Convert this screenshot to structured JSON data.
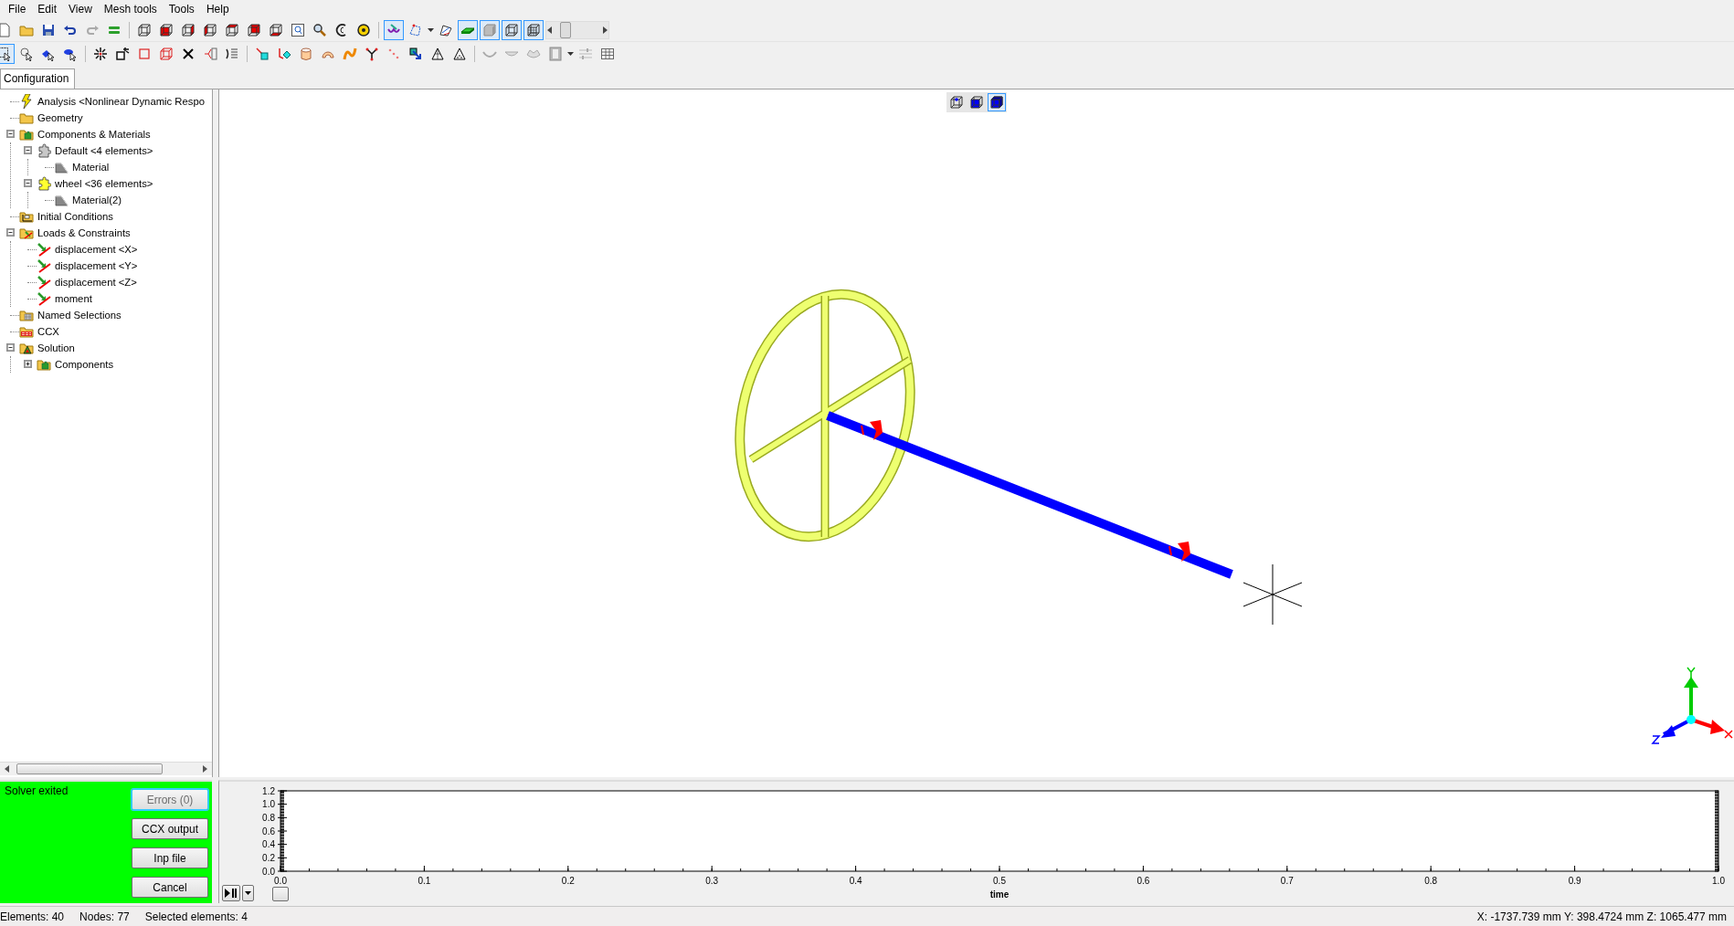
{
  "menu": [
    "File",
    "Edit",
    "View",
    "Mesh tools",
    "Tools",
    "Help"
  ],
  "tabs": [
    {
      "label": "Configuration",
      "selected": true
    }
  ],
  "tree": [
    {
      "kind": "analysis",
      "label": "Analysis <Nonlinear Dynamic Respo"
    },
    {
      "kind": "folder",
      "label": "Geometry"
    },
    {
      "kind": "components",
      "label": "Components & Materials",
      "expanded": true,
      "children": [
        {
          "kind": "part",
          "color": "#c8c8c8",
          "label": "Default <4 elements>",
          "expanded": true,
          "children": [
            {
              "kind": "material",
              "label": "Material"
            }
          ]
        },
        {
          "kind": "part",
          "color": "#ffff30",
          "label": "wheel <36 elements>",
          "expanded": true,
          "children": [
            {
              "kind": "material",
              "label": "Material(2)"
            }
          ]
        }
      ]
    },
    {
      "kind": "conditions",
      "label": "Initial Conditions"
    },
    {
      "kind": "loads",
      "label": "Loads & Constraints",
      "expanded": true,
      "children": [
        {
          "kind": "load",
          "label": "displacement <X>"
        },
        {
          "kind": "load",
          "label": "displacement <Y>"
        },
        {
          "kind": "load",
          "label": "displacement <Z>"
        },
        {
          "kind": "load",
          "label": "moment"
        }
      ]
    },
    {
      "kind": "selections",
      "label": "Named Selections"
    },
    {
      "kind": "ccx",
      "label": "CCX"
    },
    {
      "kind": "solution",
      "label": "Solution",
      "expanded": true,
      "children": [
        {
          "kind": "components",
          "label": "Components",
          "expanded": false
        }
      ]
    }
  ],
  "view_modes": [
    {
      "selected": false
    },
    {
      "selected": false
    },
    {
      "selected": true
    }
  ],
  "solver": {
    "status": "Solver exited",
    "buttons": [
      {
        "label": "Errors (0)",
        "disabled": true
      },
      {
        "label": "CCX output",
        "disabled": false
      },
      {
        "label": "Inp file",
        "disabled": false
      },
      {
        "label": "Cancel",
        "disabled": false
      }
    ]
  },
  "chart": {
    "time_slider": {
      "level": 0
    },
    "chart_data": {
      "type": "line",
      "xlabel": "time",
      "xlim": [
        0,
        1
      ],
      "ylim": [
        0,
        1.2
      ],
      "xticks": [
        {
          "value": 0,
          "label": "0.0"
        },
        0.1,
        0.2,
        0.3,
        0.4,
        0.5,
        0.6,
        0.7,
        0.8,
        0.9,
        {
          "value": 1,
          "label": "1.0"
        }
      ],
      "yticks": [
        {
          "value": 0,
          "label": "0.0"
        },
        0.2,
        0.4,
        0.6,
        0.8,
        {
          "value": 1,
          "label": "1.0"
        },
        1.2
      ]
    }
  },
  "status_bar": {
    "elements": "Elements: 40",
    "nodes": "Nodes: 77",
    "selected": "Selected elements: 4",
    "coordinates": "X: -1737.739 mm Y: 398.4724 mm Z: 1065.477 mm"
  }
}
